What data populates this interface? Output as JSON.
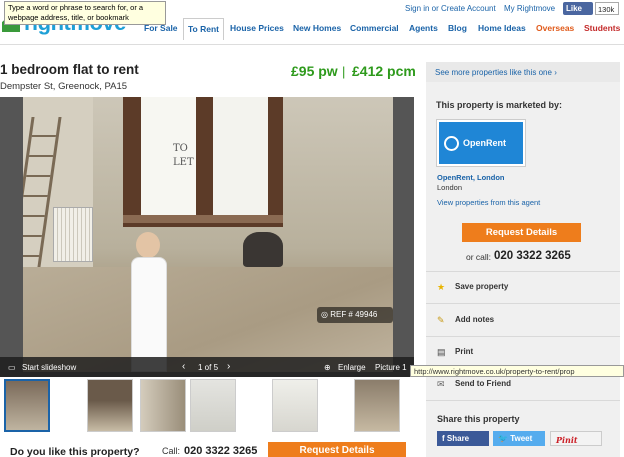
{
  "browser": {
    "tooltip": "Type a word or phrase to search for, or a webpage address, title, or bookmark",
    "status_url": "http://www.rightmove.co.uk/property-to-rent/prop"
  },
  "header": {
    "logo_text": "rightmove",
    "sign_in": "Sign in or Create Account",
    "my_rightmove": "My Rightmove",
    "fb_like": "Like",
    "fb_count": "130k",
    "nav": [
      {
        "label": "For Sale",
        "color": "#1a63a8"
      },
      {
        "label": "To Rent",
        "color": "#1a63a8"
      },
      {
        "label": "House Prices",
        "color": "#1a63a8"
      },
      {
        "label": "New Homes",
        "color": "#1a63a8"
      },
      {
        "label": "Commercial",
        "color": "#1a63a8"
      },
      {
        "label": "Agents",
        "color": "#1a63a8"
      },
      {
        "label": "Blog",
        "color": "#1a63a8"
      },
      {
        "label": "Home Ideas",
        "color": "#1a63a8"
      },
      {
        "label": "Overseas",
        "color": "#e05a1a"
      },
      {
        "label": "Students",
        "color": "#c42b2b"
      }
    ]
  },
  "listing": {
    "title": "1 bedroom flat to rent",
    "address": "Dempster St, Greenock, PA15",
    "price_pw": "£95 pw",
    "price_sep": "|",
    "price_pcm": "£412 pcm",
    "window_sign": "TO LET",
    "ref": "REF # 49946"
  },
  "gallery": {
    "start_slideshow": "Start slideshow",
    "counter": "1 of 5",
    "enlarge": "Enlarge",
    "picture": "Picture 1"
  },
  "bottom": {
    "question": "Do you like this property?",
    "call_label": "Call:",
    "phone": "020 3322 3265",
    "request_btn": "Request Details"
  },
  "sidebar": {
    "see_more": "See more properties like this one",
    "marketed_by": "This property is marketed by:",
    "agent_logo_text": "OpenRent",
    "agent_name": "OpenRent, London",
    "agent_city": "London",
    "agent_link": "View properties from this agent",
    "request_btn": "Request Details",
    "or_call": "or call:",
    "phone": "020 3322 3265",
    "actions": [
      {
        "label": "Save property",
        "icon": "star-icon"
      },
      {
        "label": "Add notes",
        "icon": "pencil-icon"
      },
      {
        "label": "Print",
        "icon": "printer-icon"
      },
      {
        "label": "Send to Friend",
        "icon": "envelope-icon"
      }
    ],
    "share_heading": "Share this property",
    "share": [
      {
        "label": "Share",
        "color": "#3b5998"
      },
      {
        "label": "Tweet",
        "color": "#55acee"
      },
      {
        "label": "Pinit",
        "color": "#cb2027"
      }
    ]
  }
}
